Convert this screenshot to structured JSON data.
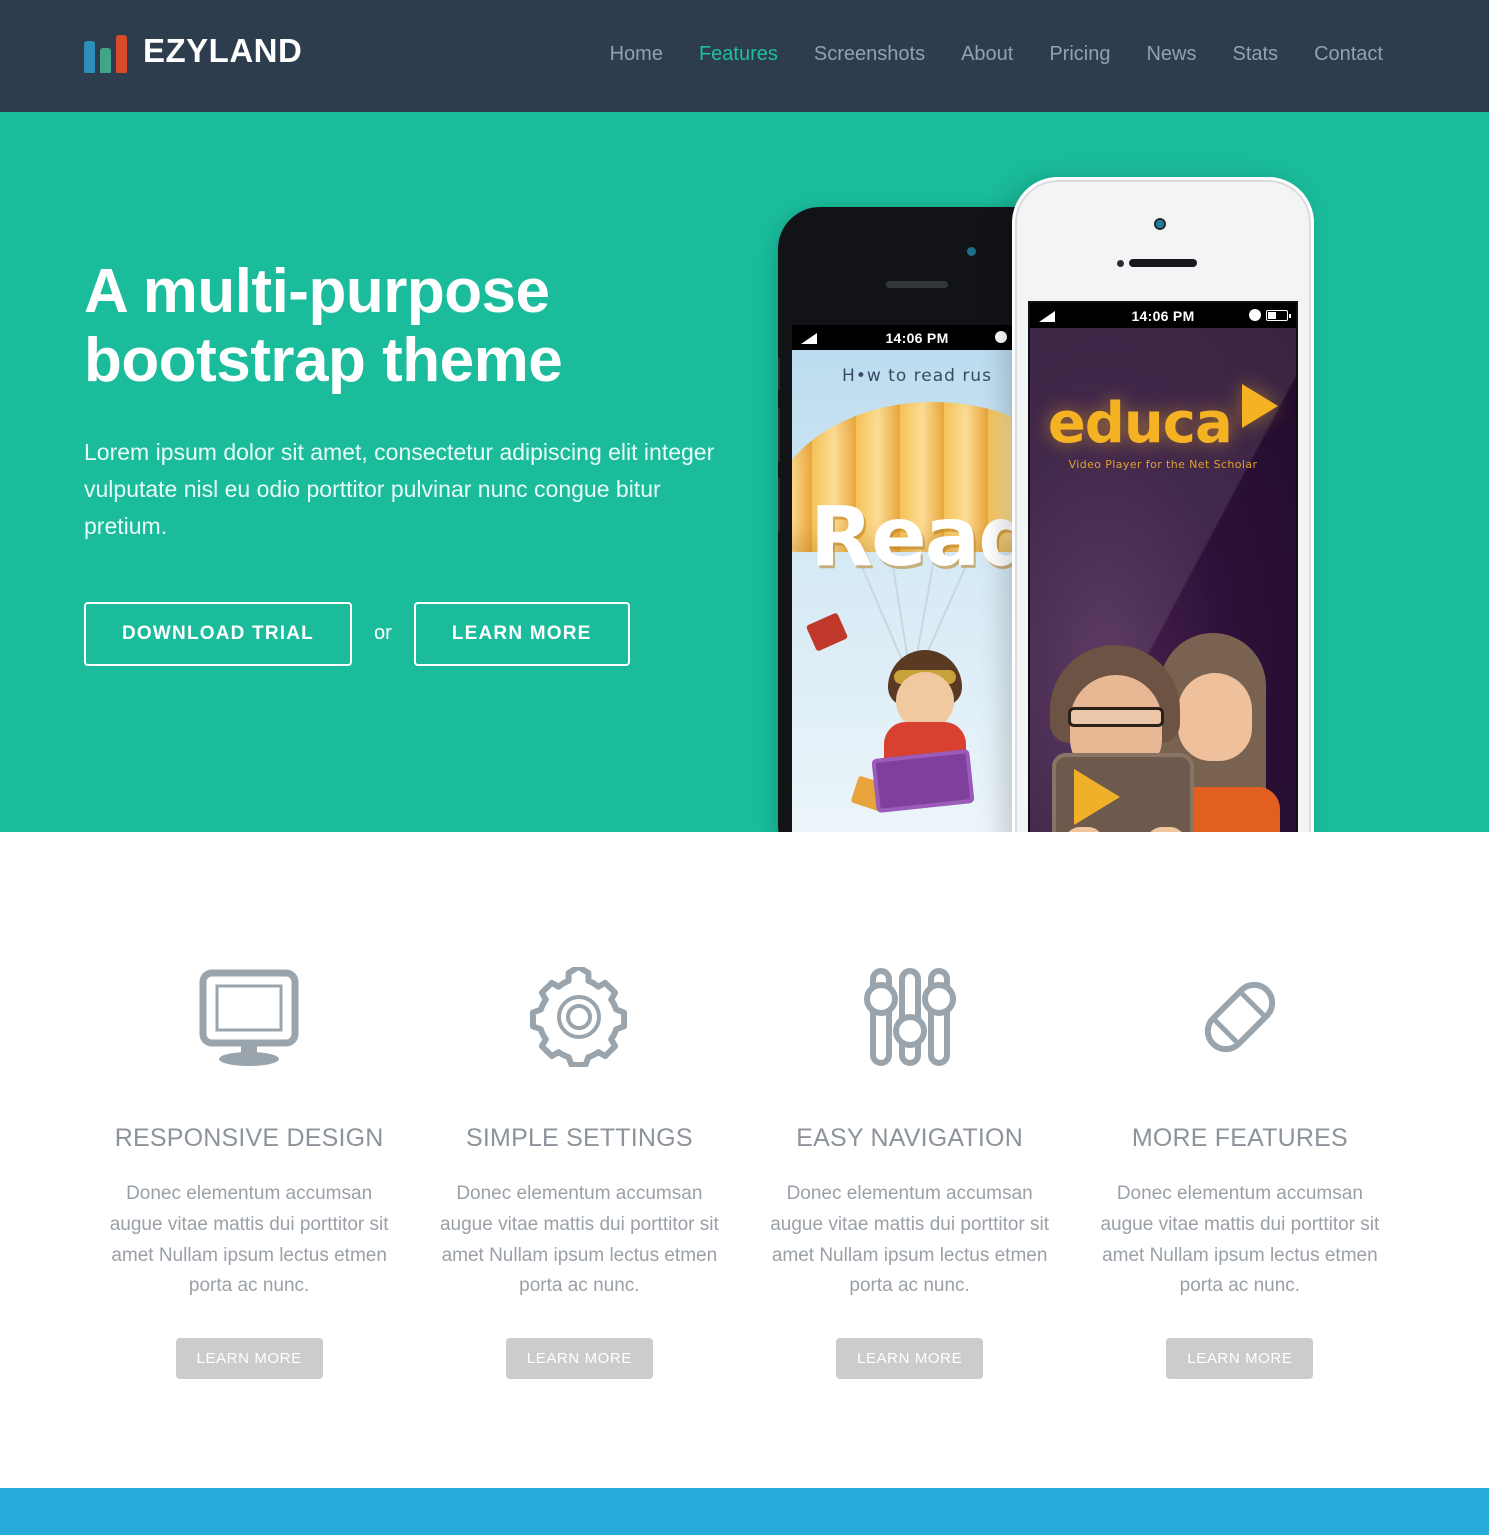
{
  "header": {
    "brand": {
      "name": "EZYLAND",
      "logo_colors": [
        "#2d8dbb",
        "#3fa787",
        "#d94a2b"
      ]
    },
    "nav": [
      {
        "label": "Home",
        "active": false
      },
      {
        "label": "Features",
        "active": true
      },
      {
        "label": "Screenshots",
        "active": false
      },
      {
        "label": "About",
        "active": false
      },
      {
        "label": "Pricing",
        "active": false
      },
      {
        "label": "News",
        "active": false
      },
      {
        "label": "Stats",
        "active": false
      },
      {
        "label": "Contact",
        "active": false
      }
    ],
    "bg_color": "#2e3d4e",
    "active_color": "#1fbf9c"
  },
  "hero": {
    "title_line1": "A multi-purpose",
    "title_line2": "bootstrap theme",
    "subtitle": "Lorem ipsum dolor sit amet, consectetur adipiscing elit integer vulputate nisl eu odio porttitor pulvinar nunc congue bitur pretium.",
    "primary_button": "DOWNLOAD TRIAL",
    "separator": "or",
    "secondary_button": "LEARN MORE",
    "bg_color": "#1abc9c",
    "phones": {
      "black": {
        "status_time": "14:06 PM",
        "app_heading": "H•w to read rus",
        "app_title": "Read"
      },
      "white": {
        "status_time": "14:06 PM",
        "app_title": "educa",
        "app_tagline": "Video Player for the Net Scholar"
      }
    }
  },
  "features": {
    "items": [
      {
        "icon": "monitor-icon",
        "title": "RESPONSIVE DESIGN",
        "text": "Donec elementum accumsan augue vitae mattis dui porttitor sit amet Nullam ipsum lectus etmen porta ac nunc.",
        "button": "LEARN MORE"
      },
      {
        "icon": "gear-icon",
        "title": "SIMPLE SETTINGS",
        "text": "Donec elementum accumsan augue vitae mattis dui porttitor sit amet Nullam ipsum lectus etmen porta ac nunc.",
        "button": "LEARN MORE"
      },
      {
        "icon": "sliders-icon",
        "title": "EASY NAVIGATION",
        "text": "Donec elementum accumsan augue vitae mattis dui porttitor sit amet Nullam ipsum lectus etmen porta ac nunc.",
        "button": "LEARN MORE"
      },
      {
        "icon": "pencil-icon",
        "title": "MORE FEATURES",
        "text": "Donec elementum accumsan augue vitae mattis dui porttitor sit amet Nullam ipsum lectus etmen porta ac nunc.",
        "button": "LEARN MORE"
      }
    ],
    "icon_color": "#9aa4ad",
    "button_color": "#cccccc"
  },
  "bottom_band": {
    "color": "#29aadd"
  }
}
